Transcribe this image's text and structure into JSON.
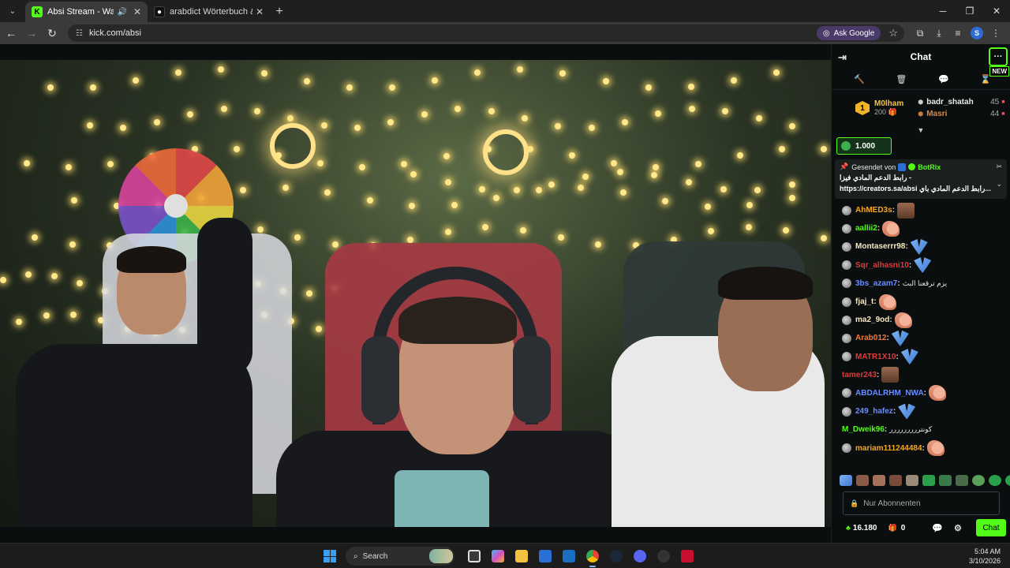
{
  "browser": {
    "tabs": [
      {
        "title": "Absi Stream - Watch Live o",
        "active": true
      },
      {
        "title": "arabdict Wörterbuch & Überse",
        "active": false
      }
    ],
    "url": "kick.com/absi",
    "ask_google": "Ask Google",
    "profile_initial": "S"
  },
  "chat": {
    "title": "Chat",
    "new_badge": "NEW",
    "leaderboard": {
      "rank": "1",
      "first": {
        "name": "M0lham",
        "count": "200"
      },
      "second": {
        "name": "badr_shatah",
        "count": "45"
      },
      "third": {
        "name": "Masri",
        "count": "44"
      }
    },
    "kicks_goal": "1.000",
    "pinned": {
      "sent_by": "Gesendet von",
      "bot_name": "BotRix",
      "line1": "- رابط الدعم المادي فيزا",
      "line2": "https://creators.sa/absi رابط الدعم المادي باي..."
    },
    "messages": [
      {
        "user": "AhMED3s",
        "color": "#f5a623",
        "badge": true,
        "emote": "face",
        "text": ""
      },
      {
        "user": "aallii2",
        "color": "#53fc18",
        "badge": true,
        "emote": "hand",
        "text": ""
      },
      {
        "user": "Montaserrr98",
        "color": "#f6e7c1",
        "badge": true,
        "emote": "fly",
        "text": ""
      },
      {
        "user": "Sqr_alhasni10",
        "color": "#e03a3a",
        "badge": true,
        "emote": "fly",
        "text": ""
      },
      {
        "user": "3bs_azam7",
        "color": "#6a8dff",
        "badge": true,
        "emote": "",
        "text": "يزم ترقعنا البث"
      },
      {
        "user": "fjaj_t",
        "color": "#f6e7c1",
        "badge": true,
        "emote": "hand",
        "text": ""
      },
      {
        "user": "ma2_9od",
        "color": "#f6e7c1",
        "badge": true,
        "emote": "hand",
        "text": ""
      },
      {
        "user": "Arab012",
        "color": "#f07a3a",
        "badge": true,
        "emote": "fly",
        "text": ""
      },
      {
        "user": "MATR1X10",
        "color": "#e03a3a",
        "badge": true,
        "emote": "fly",
        "text": ""
      },
      {
        "user": "tamer243",
        "color": "#e03a3a",
        "badge": false,
        "emote": "face",
        "text": ""
      },
      {
        "user": "ABDALRHM_NWA",
        "color": "#6a8dff",
        "badge": true,
        "emote": "hand",
        "text": ""
      },
      {
        "user": "249_hafez",
        "color": "#6a8dff",
        "badge": true,
        "emote": "fly",
        "text": ""
      },
      {
        "user": "M_Dweik96",
        "color": "#53fc18",
        "badge": false,
        "emote": "",
        "text": "كونتررررررررر"
      },
      {
        "user": "mariam111244484",
        "color": "#f5a623",
        "badge": true,
        "emote": "hand",
        "text": ""
      }
    ],
    "input_placeholder": "Nur Abonnenten",
    "footer": {
      "kicks": "16.180",
      "subs": "0",
      "send": "Chat"
    }
  },
  "taskbar": {
    "search_label": "Search",
    "time": "5:04 AM",
    "date": "3/10/2026"
  }
}
